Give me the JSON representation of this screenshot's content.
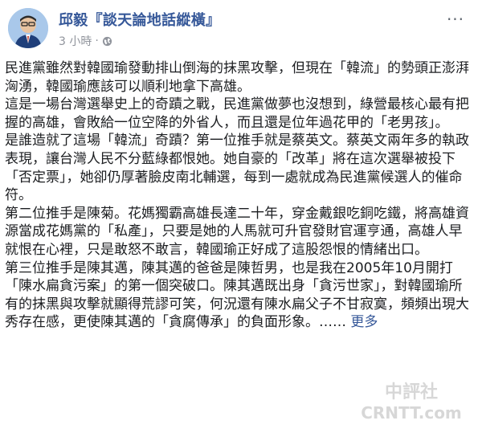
{
  "post": {
    "author": "邱毅『談天論地話縱橫』",
    "timestamp": "3 小時",
    "separator": "·",
    "privacy_icon": "globe-icon",
    "options_icon": "more-options-icon",
    "paragraphs": [
      "民進黨雖然對韓國瑜發動排山倒海的抹黑攻擊，但現在「韓流」的勢頭正澎湃洶湧，韓國瑜應該可以順利地拿下高雄。",
      "這是一場台灣選舉史上的奇蹟之戰，民進黨做夢也沒想到，綠營最核心最有把握的高雄，會敗給一位空降的外省人，而且還是位年過花甲的「老男孩」。",
      "是誰造就了這場「韓流」奇蹟？第一位推手就是蔡英文。蔡英文兩年多的執政表現，讓台灣人民不分藍綠都恨她。她自豪的「改革」將在這次選舉被投下「否定票」，她卻仍厚著臉皮南北輔選，每到一處就成為民進黨候選人的催命符。",
      "第二位推手是陳菊。花媽獨霸高雄長達二十年，穿金戴銀吃銅吃鐵，將高雄資源當成花媽黨的「私產」，只要是她的人馬就可升官發財官運亨通，高雄人早就恨在心裡，只是敢怒不敢言，韓國瑜正好成了這股怨恨的情緒出口。",
      "第三位推手是陳其邁，陳其邁的爸爸是陳哲男，也是我在2005年10月開打「陳水扁貪污案」的第一個突破口。陳其邁既出身「貪污世家」，對韓國瑜所有的抹黑與攻擊就顯得荒謬可笑，何況還有陳水扁父子不甘寂寞，頻頻出現大秀存在感，更使陳其邁的「貪腐傳承」的負面形象。……"
    ],
    "see_more_label": "更多"
  },
  "watermark": {
    "text_cn": "中評社",
    "text_en": "CRNTT.com"
  },
  "colors": {
    "link": "#365899",
    "meta": "#90949c",
    "text": "#1c1e21"
  }
}
